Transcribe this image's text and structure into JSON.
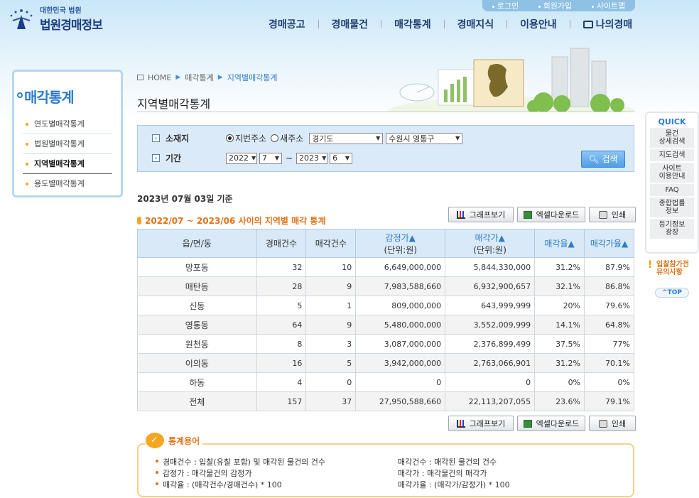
{
  "util": {
    "login": "로그인",
    "join": "회원가입",
    "sitemap": "사이트맵"
  },
  "logo": {
    "sub": "대한민국 법원",
    "main": "법원경매정보"
  },
  "nav": [
    "경매공고",
    "경매물건",
    "매각통계",
    "경매지식",
    "이용안내",
    "나의경매"
  ],
  "sidebar": {
    "title": "매각통계",
    "items": [
      "연도별매각통계",
      "법원별매각통계",
      "지역별매각통계",
      "용도별매각통계"
    ],
    "active_index": 2
  },
  "breadcrumb": {
    "home": "HOME",
    "level1": "매각통계",
    "level2": "지역별매각통계"
  },
  "page_title": "지역별매각통계",
  "search": {
    "location_label": "소재지",
    "radio_lot": "지번주소",
    "radio_road": "새주소",
    "radio_selected": "지번주소",
    "province": "경기도",
    "district": "수원시 영통구",
    "period_label": "기간",
    "from_year": "2022",
    "from_month": "7",
    "tilde": "~",
    "to_year": "2023",
    "to_month": "6",
    "search_button": "검색"
  },
  "as_of": "2023년 07월 03일 기준",
  "subtitle": "2022/07 ~ 2023/06 사이의 지역별 매각 통계",
  "buttons": {
    "graph": "그래프보기",
    "excel": "엑셀다운로드",
    "print": "인쇄"
  },
  "table": {
    "headers": {
      "region": "읍/면/동",
      "auction_count": "경매건수",
      "sold_count": "매각건수",
      "appraisal": "감정가▲",
      "appraisal_unit": "(단위:원)",
      "sale_price": "매각가▲",
      "sale_price_unit": "(단위:원)",
      "sale_rate": "매각율▲",
      "price_rate": "매각가율▲"
    },
    "rows": [
      [
        "망포동",
        "32",
        "10",
        "6,649,000,000",
        "5,844,330,000",
        "31.2%",
        "87.9%"
      ],
      [
        "매탄동",
        "28",
        "9",
        "7,983,588,660",
        "6,932,900,657",
        "32.1%",
        "86.8%"
      ],
      [
        "신동",
        "5",
        "1",
        "809,000,000",
        "643,999,999",
        "20%",
        "79.6%"
      ],
      [
        "영통동",
        "64",
        "9",
        "5,480,000,000",
        "3,552,009,999",
        "14.1%",
        "64.8%"
      ],
      [
        "원천동",
        "8",
        "3",
        "3,087,000,000",
        "2,376,899,499",
        "37.5%",
        "77%"
      ],
      [
        "이의동",
        "16",
        "5",
        "3,942,000,000",
        "2,763,066,901",
        "31.2%",
        "70.1%"
      ],
      [
        "하동",
        "4",
        "0",
        "0",
        "0",
        "0%",
        "0%"
      ],
      [
        "전체",
        "157",
        "37",
        "27,950,588,660",
        "22,113,207,055",
        "23.6%",
        "79.1%"
      ]
    ]
  },
  "glossary": {
    "title": "통계용어",
    "auction_count": "경매건수 : 입찰(유찰 포함) 및 매각된 물건의 건수",
    "sold_count": "매각건수 : 매각된 물건의 건수",
    "appraisal": "감정가 : 매각물건의 감정가",
    "sale_price": "매각가 : 매각물건의 매각가",
    "sale_rate": "매각율 : (매각건수/경매건수) * 100",
    "price_rate": "매각가율 : (매각가/감정가) * 100"
  },
  "quick": {
    "title": "QUICK",
    "items": [
      [
        "물건",
        "상세검색"
      ],
      [
        "지도검색",
        ""
      ],
      [
        "사이트",
        "이용안내"
      ],
      [
        "FAQ",
        ""
      ],
      [
        "종합법률",
        "정보"
      ],
      [
        "등기정보",
        "광장"
      ]
    ],
    "notice_line1": "입찰참가전",
    "notice_line2": "유의사항",
    "top": "TOP"
  }
}
